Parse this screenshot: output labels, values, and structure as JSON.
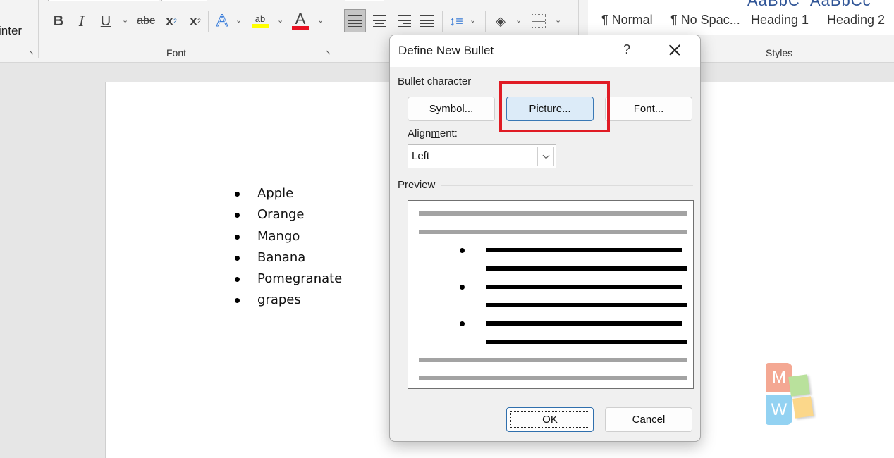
{
  "ribbon": {
    "clipboard_partial_label": "inter",
    "font_group_label": "Font",
    "styles_group_label": "Styles",
    "font_buttons": {
      "bold": "B",
      "italic": "I",
      "underline": "U",
      "strikethrough": "abc",
      "subscript": "x",
      "subscript_sub": "2",
      "superscript": "x",
      "superscript_sup": "2",
      "text_effects": "A",
      "highlight": "ab",
      "font_color": "A"
    },
    "colors": {
      "highlight": "#ffff00",
      "font_color": "#e81123"
    },
    "styles": [
      {
        "label": "¶ Normal"
      },
      {
        "label": "¶ No Spac..."
      },
      {
        "label": "Heading 1"
      },
      {
        "label": "Heading 2"
      }
    ]
  },
  "document": {
    "list_items": [
      "Apple",
      "Orange",
      "Mango",
      "Banana",
      "Pomegranate",
      "grapes"
    ]
  },
  "dialog": {
    "title": "Define New Bullet",
    "help_label": "?",
    "bullet_character_label": "Bullet character",
    "symbol_button": {
      "mnemonic": "S",
      "rest": "ymbol..."
    },
    "picture_button": {
      "mnemonic": "P",
      "rest": "icture..."
    },
    "font_button": {
      "mnemonic": "F",
      "rest": "ont..."
    },
    "alignment_label": {
      "pre": "Align",
      "mnemonic": "m",
      "post": "ent:"
    },
    "alignment_value": "Left",
    "preview_label": "Preview",
    "ok_label": "OK",
    "cancel_label": "Cancel",
    "highlight_color": "#e01b24"
  },
  "logo": {
    "top_letter": "M",
    "bottom_letter": "W"
  }
}
